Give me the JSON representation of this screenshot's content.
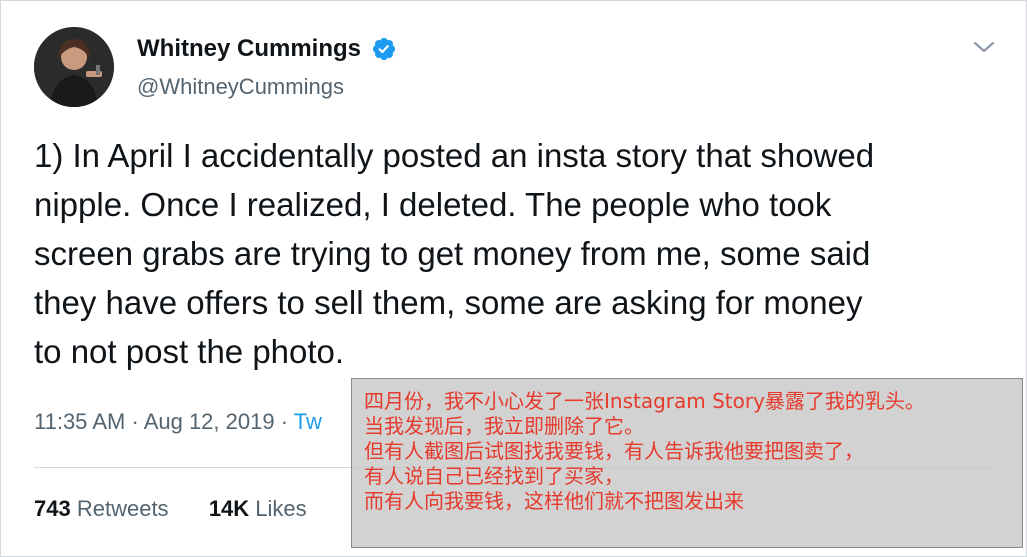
{
  "user": {
    "display_name": "Whitney Cummings",
    "handle": "@WhitneyCummings",
    "verified": true
  },
  "tweet": {
    "lines": [
      "1) In April I accidentally posted an insta story that showed",
      "nipple. Once I realized, I deleted. The people who took",
      "screen grabs are trying to get money from me, some said",
      "they have offers to sell them, some are asking for money",
      "to not post the photo."
    ],
    "time": "11:35 AM",
    "separator": "·",
    "date": "Aug 12, 2019",
    "source_partial": "Tw"
  },
  "stats": {
    "retweets_count": "743",
    "retweets_label": "Retweets",
    "likes_count": "14K",
    "likes_label": "Likes"
  },
  "translation_overlay": {
    "lines": [
      "四月份，我不小心发了一张Instagram Story暴露了我的乳头。",
      "当我发现后，我立即删除了它。",
      "但有人截图后试图找我要钱，有人告诉我他要把图卖了，",
      "有人说自己已经找到了买家，",
      "而有人向我要钱，这样他们就不把图发出来"
    ]
  },
  "colors": {
    "verified_blue": "#1d9bf0",
    "text_primary": "#0f1419",
    "text_secondary": "#536471",
    "overlay_text": "#e63a2c"
  },
  "icons": {
    "verified": "verified-badge-icon",
    "caret": "chevron-down-icon"
  }
}
